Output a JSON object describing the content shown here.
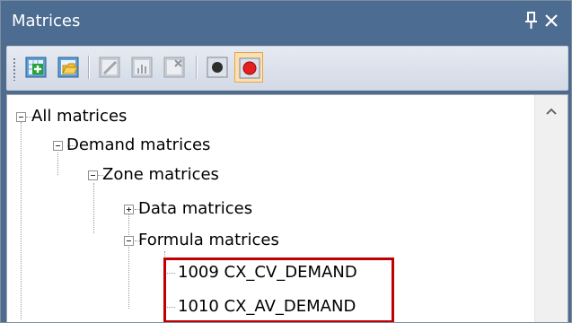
{
  "panel": {
    "title": "Matrices",
    "pin_icon": "pin-icon",
    "close_icon": "close-icon",
    "title_color": "#4d6c91"
  },
  "toolbar": {
    "buttons": [
      {
        "name": "new-matrix-button",
        "icon": "new-matrix-icon",
        "enabled": true
      },
      {
        "name": "open-folder-button",
        "icon": "open-folder-icon",
        "enabled": true
      },
      {
        "name": "edit-matrix-button",
        "icon": "edit-matrix-icon",
        "enabled": false
      },
      {
        "name": "chart-button",
        "icon": "chart-icon",
        "enabled": false
      },
      {
        "name": "delete-matrix-button",
        "icon": "delete-matrix-icon",
        "enabled": false
      },
      {
        "name": "record-button",
        "icon": "record-icon",
        "enabled": true
      },
      {
        "name": "record-active-button",
        "icon": "record-active-icon",
        "enabled": true,
        "pressed": true
      }
    ]
  },
  "tree": {
    "root": {
      "label": "All matrices",
      "expanded": true
    },
    "demand": {
      "label": "Demand matrices",
      "expanded": true
    },
    "zone": {
      "label": "Zone matrices",
      "expanded": true
    },
    "data": {
      "label": "Data matrices",
      "expanded": false
    },
    "formula": {
      "label": "Formula matrices",
      "expanded": true
    },
    "items": [
      {
        "label": "1009 CX_CV_DEMAND"
      },
      {
        "label": "1010 CX_AV_DEMAND"
      }
    ],
    "highlight_color": "#c00000"
  }
}
